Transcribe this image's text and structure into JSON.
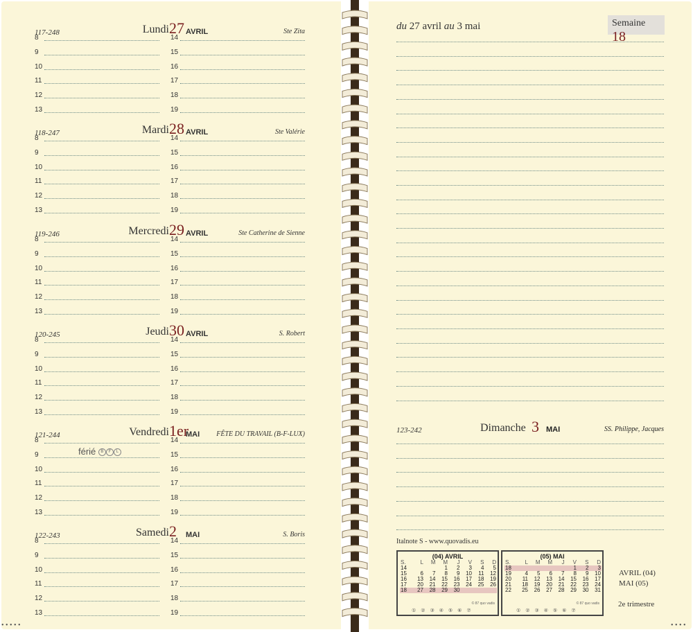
{
  "week": {
    "range_prefix": "du",
    "range_start": "27 avril",
    "range_mid": "au",
    "range_end": "3 mai",
    "label": "Semaine",
    "number": "18"
  },
  "hours_left": [
    "8",
    "9",
    "10",
    "11",
    "12",
    "13"
  ],
  "hours_right": [
    "14",
    "15",
    "16",
    "17",
    "18",
    "19"
  ],
  "days": [
    {
      "num": "117-248",
      "name": "Lundi",
      "day": "27",
      "month": "AVRIL",
      "saint": "Ste Zita"
    },
    {
      "num": "118-247",
      "name": "Mardi",
      "day": "28",
      "month": "AVRIL",
      "saint": "Ste Valérie"
    },
    {
      "num": "119-246",
      "name": "Mercredi",
      "day": "29",
      "month": "AVRIL",
      "saint": "Ste Catherine de Sienne"
    },
    {
      "num": "120-245",
      "name": "Jeudi",
      "day": "30",
      "month": "AVRIL",
      "saint": "S. Robert"
    },
    {
      "num": "121-244",
      "name": "Vendredi",
      "day": "1er",
      "month": "MAI",
      "saint": "FÊTE DU TRAVAIL (B-F-LUX)"
    },
    {
      "num": "122-243",
      "name": "Samedi",
      "day": "2",
      "month": "MAI",
      "saint": "S. Boris"
    }
  ],
  "ferie": {
    "label": "férié",
    "codes": [
      "B",
      "F",
      "L"
    ]
  },
  "sunday": {
    "num": "123-242",
    "name": "Dimanche",
    "day": "3",
    "month": "MAI",
    "saint": "SS. Philippe, Jacques"
  },
  "footer": "Italnote S - www.quovadis.eu",
  "calendars": [
    {
      "title": "(04) AVRIL",
      "head": [
        "S.",
        "L",
        "M",
        "M",
        "J",
        "V",
        "S",
        "D"
      ],
      "rows": [
        [
          "14",
          "",
          "",
          "1",
          "2",
          "3",
          "4",
          "5"
        ],
        [
          "15",
          "6",
          "7",
          "8",
          "9",
          "10",
          "11",
          "12"
        ],
        [
          "16",
          "13",
          "14",
          "15",
          "16",
          "17",
          "18",
          "19"
        ],
        [
          "17",
          "20",
          "21",
          "22",
          "23",
          "24",
          "25",
          "26"
        ],
        [
          "18",
          "27",
          "28",
          "29",
          "30",
          "",
          "",
          ""
        ]
      ],
      "copy": "© 87 quo vadis",
      "circles": "① ② ③ ④ ⑤ ⑥ ⑦"
    },
    {
      "title": "(05) MAI",
      "head": [
        "S.",
        "L",
        "M",
        "M",
        "J",
        "V",
        "S",
        "D"
      ],
      "rows": [
        [
          "18",
          "",
          "",
          "",
          "",
          "1",
          "2",
          "3"
        ],
        [
          "19",
          "4",
          "5",
          "6",
          "7",
          "8",
          "9",
          "10"
        ],
        [
          "20",
          "11",
          "12",
          "13",
          "14",
          "15",
          "16",
          "17"
        ],
        [
          "21",
          "18",
          "19",
          "20",
          "21",
          "22",
          "23",
          "24"
        ],
        [
          "22",
          "25",
          "26",
          "27",
          "28",
          "29",
          "30",
          "31"
        ]
      ],
      "copy": "© 87 quo vadis",
      "circles": "① ② ③ ④ ⑤ ⑥ ⑦"
    }
  ],
  "side": {
    "line1": "AVRIL (04)",
    "line2": "MAI (05)",
    "trimestre": "2e trimestre"
  },
  "colors": {
    "paper": "#fbf6d9",
    "accent": "#7a1f1f",
    "rule": "#6b8a87"
  }
}
